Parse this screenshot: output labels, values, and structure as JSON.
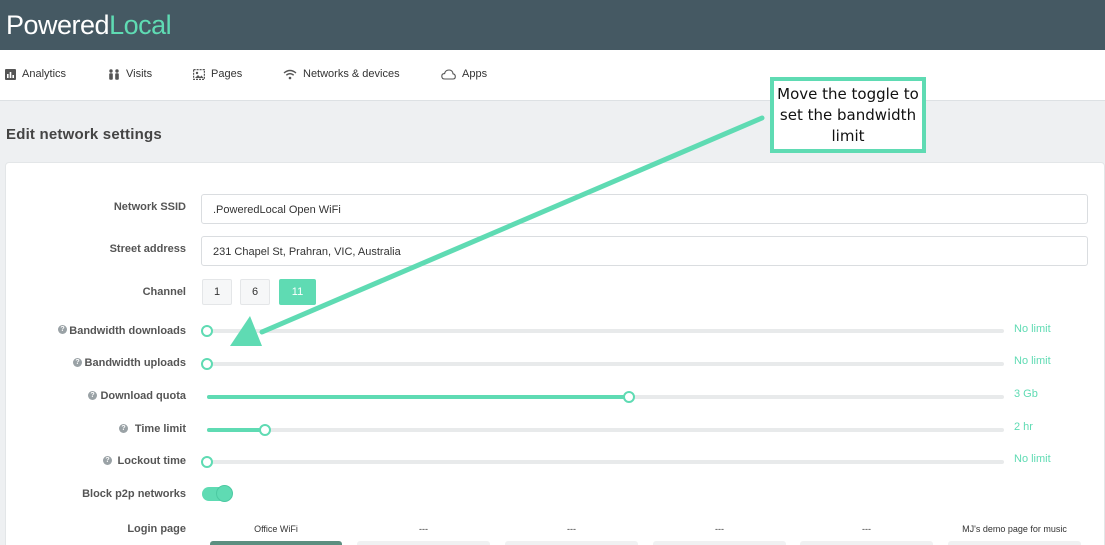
{
  "brand": {
    "part1": "Powered",
    "part2": "Local"
  },
  "nav": {
    "items": [
      {
        "label": "Analytics",
        "icon": "bar-chart-icon"
      },
      {
        "label": "Visits",
        "icon": "people-icon"
      },
      {
        "label": "Pages",
        "icon": "image-icon"
      },
      {
        "label": "Networks & devices",
        "icon": "wifi-icon"
      },
      {
        "label": "Apps",
        "icon": "cloud-icon"
      }
    ]
  },
  "page": {
    "title": "Edit network settings"
  },
  "form": {
    "ssid": {
      "label": "Network SSID",
      "value": ".PoweredLocal Open WiFi"
    },
    "address": {
      "label": "Street address",
      "value": "231 Chapel St, Prahran, VIC, Australia"
    },
    "channel": {
      "label": "Channel",
      "options": [
        "1",
        "6",
        "11"
      ],
      "selected": "11"
    },
    "sliders": [
      {
        "label": "Bandwidth downloads",
        "value": "No limit",
        "level": 0.0
      },
      {
        "label": "Bandwidth uploads",
        "value": "No limit",
        "level": 0.0
      },
      {
        "label": "Download quota",
        "value": "3 Gb",
        "level": 0.53
      },
      {
        "label": "Time limit",
        "value": "2 hr",
        "level": 0.073
      },
      {
        "label": "Lockout time",
        "value": "No limit",
        "level": 0.0
      }
    ],
    "p2p": {
      "label": "Block p2p networks",
      "enabled": true
    },
    "login_page": {
      "label": "Login page",
      "options": [
        "Office WiFi",
        "---",
        "---",
        "---",
        "---",
        "MJ's demo page for music"
      ],
      "selected": "Office WiFi"
    }
  },
  "callout": {
    "text": "Move the toggle to set the bandwidth limit"
  },
  "colors": {
    "accent": "#5fdbb3",
    "topbar": "#455963"
  }
}
